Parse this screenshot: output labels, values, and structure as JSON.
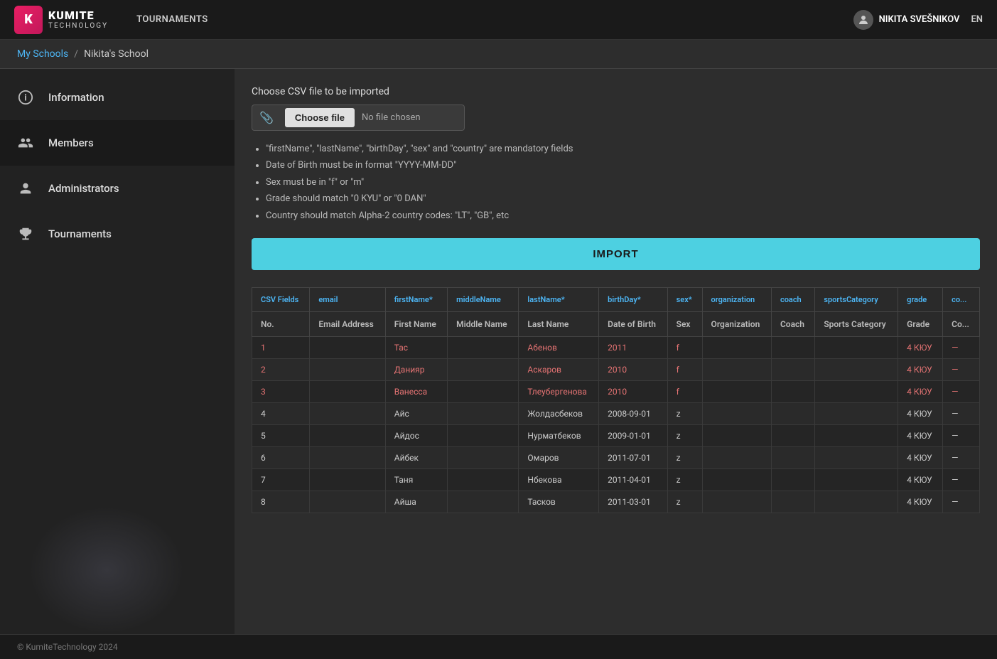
{
  "app": {
    "title": "KUMITE",
    "subtitle": "TECHNOLOGY",
    "logo_letter": "K"
  },
  "nav": {
    "tournaments_link": "TOURNAMENTS",
    "user_name": "NIKITA SVEŠNIKOV",
    "lang": "EN"
  },
  "breadcrumb": {
    "my_schools": "My Schools",
    "separator": "/",
    "current": "Nikita's School"
  },
  "sidebar": {
    "items": [
      {
        "id": "information",
        "label": "Information",
        "icon": "ℹ"
      },
      {
        "id": "members",
        "label": "Members",
        "icon": "👥"
      },
      {
        "id": "administrators",
        "label": "Administrators",
        "icon": "👤"
      },
      {
        "id": "tournaments",
        "label": "Tournaments",
        "icon": "🏆"
      }
    ]
  },
  "csv_import": {
    "section_label": "Choose CSV file to be imported",
    "choose_file_btn": "Choose file",
    "no_file_text": "No file chosen",
    "hints": [
      "\"firstName\", \"lastName\", \"birthDay\", \"sex\" and \"country\" are mandatory fields",
      "Date of Birth must be in format \"YYYY-MM-DD\"",
      "Sex must be in \"f\" or \"m\"",
      "Grade should match \"0 KYU\" or \"0 DAN\"",
      "Country should match Alpha-2 country codes: \"LT\", \"GB\", etc"
    ],
    "import_button": "IMPORT"
  },
  "table": {
    "csv_fields_row": {
      "no": "CSV Fields",
      "email": "email",
      "first_name": "firstName*",
      "middle_name": "middleName",
      "last_name": "lastName*",
      "birthday": "birthDay*",
      "sex": "sex*",
      "organization": "organization",
      "coach": "coach",
      "sports_category": "sportsCategory",
      "grade": "grade",
      "country": "co..."
    },
    "display_row": {
      "no": "No.",
      "email": "Email Address",
      "first_name": "First Name",
      "middle_name": "Middle Name",
      "last_name": "Last Name",
      "birthday": "Date of Birth",
      "sex": "Sex",
      "organization": "Organization",
      "coach": "Coach",
      "sports_category": "Sports Category",
      "grade": "Grade",
      "country": "Co..."
    },
    "rows": [
      {
        "no": "1",
        "email": "",
        "first_name": "Тас",
        "middle_name": "",
        "last_name": "Абенов",
        "birthday": "2011",
        "sex": "f",
        "org": "",
        "coach": "",
        "sports": "",
        "grade": "4 КЮУ",
        "country": "—",
        "error": true
      },
      {
        "no": "2",
        "email": "",
        "first_name": "Данияр",
        "middle_name": "",
        "last_name": "Аcкаров",
        "birthday": "2010",
        "sex": "f",
        "org": "",
        "coach": "",
        "sports": "",
        "grade": "4 КЮУ",
        "country": "—",
        "error": true
      },
      {
        "no": "3",
        "email": "",
        "first_name": "Ванесса",
        "middle_name": "",
        "last_name": "Тлеубергенова",
        "birthday": "2010",
        "sex": "f",
        "org": "",
        "coach": "",
        "sports": "",
        "grade": "4 КЮУ",
        "country": "—",
        "error": true
      },
      {
        "no": "4",
        "email": "",
        "first_name": "Айс",
        "middle_name": "",
        "last_name": "Жолдасбеков",
        "birthday": "2008-09-01",
        "sex": "z",
        "org": "",
        "coach": "",
        "sports": "",
        "grade": "4 КЮУ",
        "country": "—",
        "error": false
      },
      {
        "no": "5",
        "email": "",
        "first_name": "Айдос",
        "middle_name": "",
        "last_name": "Нурматбеков",
        "birthday": "2009-01-01",
        "sex": "z",
        "org": "",
        "coach": "",
        "sports": "",
        "grade": "4 КЮУ",
        "country": "—",
        "error": false
      },
      {
        "no": "6",
        "email": "",
        "first_name": "Айбек",
        "middle_name": "",
        "last_name": "Омаров",
        "birthday": "2011-07-01",
        "sex": "z",
        "org": "",
        "coach": "",
        "sports": "",
        "grade": "4 КЮУ",
        "country": "—",
        "error": false
      },
      {
        "no": "7",
        "email": "",
        "first_name": "Таня",
        "middle_name": "",
        "last_name": "Нбекова",
        "birthday": "2011-04-01",
        "sex": "z",
        "org": "",
        "coach": "",
        "sports": "",
        "grade": "4 КЮУ",
        "country": "—",
        "error": false
      },
      {
        "no": "8",
        "email": "",
        "first_name": "Айша",
        "middle_name": "",
        "last_name": "Тасков",
        "birthday": "2011-03-01",
        "sex": "z",
        "org": "",
        "coach": "",
        "sports": "",
        "grade": "4 КЮУ",
        "country": "—",
        "error": false
      }
    ]
  },
  "footer": {
    "text": "© KumiteTechnology 2024"
  }
}
